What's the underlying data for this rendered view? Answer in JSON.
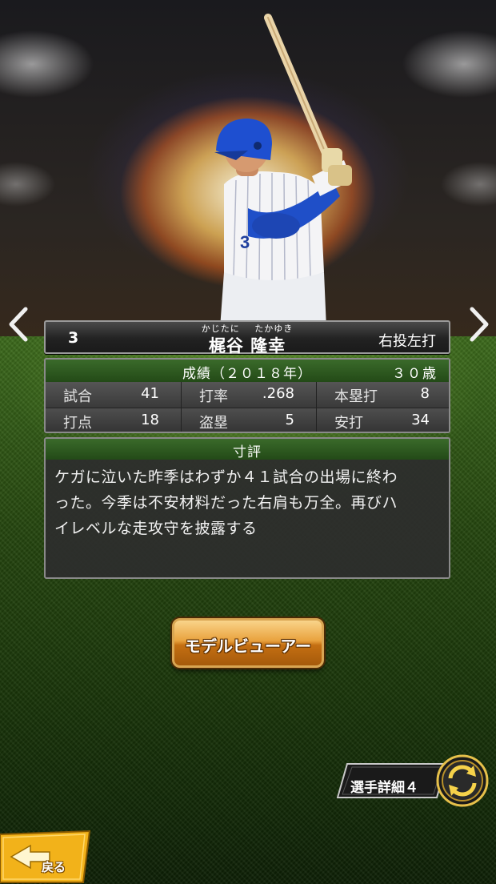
{
  "player": {
    "number": "3",
    "furigana_family": "かじたに",
    "furigana_given": "たかゆき",
    "name": "梶谷 隆幸",
    "throw_bat": "右投左打"
  },
  "stats": {
    "title": "成績（２０１８年）",
    "age": "３０歳",
    "items": [
      {
        "label": "試合",
        "value": "41"
      },
      {
        "label": "打率",
        "value": ".268"
      },
      {
        "label": "本塁打",
        "value": "8"
      },
      {
        "label": "打点",
        "value": "18"
      },
      {
        "label": "盗塁",
        "value": "5"
      },
      {
        "label": "安打",
        "value": "34"
      }
    ]
  },
  "comment": {
    "title": "寸評",
    "lines": [
      "ケガに泣いた昨季はわずか４１試合の出場に終わ",
      "った。今季は不安材料だった右肩も万全。再びハ",
      "イレベルな走攻守を披露する"
    ]
  },
  "buttons": {
    "model_viewer": "モデルビューアー",
    "detail": "選手詳細４",
    "back": "戻る"
  },
  "icons": {
    "prev": "chevron-left-icon",
    "next": "chevron-right-icon",
    "switch": "refresh-arrows-icon",
    "back": "back-arrow-icon"
  },
  "colors": {
    "panel_header_green": "#2f5e22",
    "button_orange": "#e9a23e",
    "uniform_blue": "#1f4fc8"
  }
}
